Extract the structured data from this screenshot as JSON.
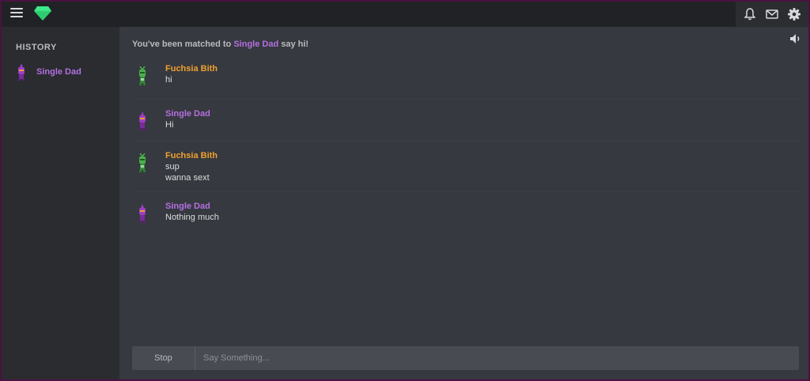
{
  "header": {
    "menu_icon": "hamburger-menu-icon",
    "logo_icon": "green-gem-logo",
    "right_icons": [
      "bell-icon",
      "mail-icon",
      "gear-icon"
    ]
  },
  "sidebar": {
    "title": "HISTORY",
    "items": [
      {
        "label": "Single Dad",
        "avatar": "purple-avatar"
      }
    ]
  },
  "main": {
    "notice_prefix": "You've been matched to",
    "notice_name": "Single Dad",
    "notice_suffix": "say hi!",
    "speaker_icon": "speaker-icon",
    "messages": [
      {
        "author": "Fuchsia Bith",
        "author_color": "#f0a030",
        "lines": [
          "hi"
        ]
      },
      {
        "author": "Single Dad",
        "author_color": "#b56fe0",
        "lines": [
          "Hi"
        ]
      },
      {
        "author": "Fuchsia Bith",
        "author_color": "#f0a030",
        "lines": [
          "sup",
          "wanna sext"
        ]
      },
      {
        "author": "Single Dad",
        "author_color": "#b56fe0",
        "lines": [
          "Nothing much"
        ]
      }
    ]
  },
  "composer": {
    "stop_label": "Stop",
    "placeholder": "Say Something..."
  },
  "colors": {
    "accent_purple": "#b56fe0",
    "accent_orange": "#f0a030",
    "logo_green": "#2ecc71"
  }
}
